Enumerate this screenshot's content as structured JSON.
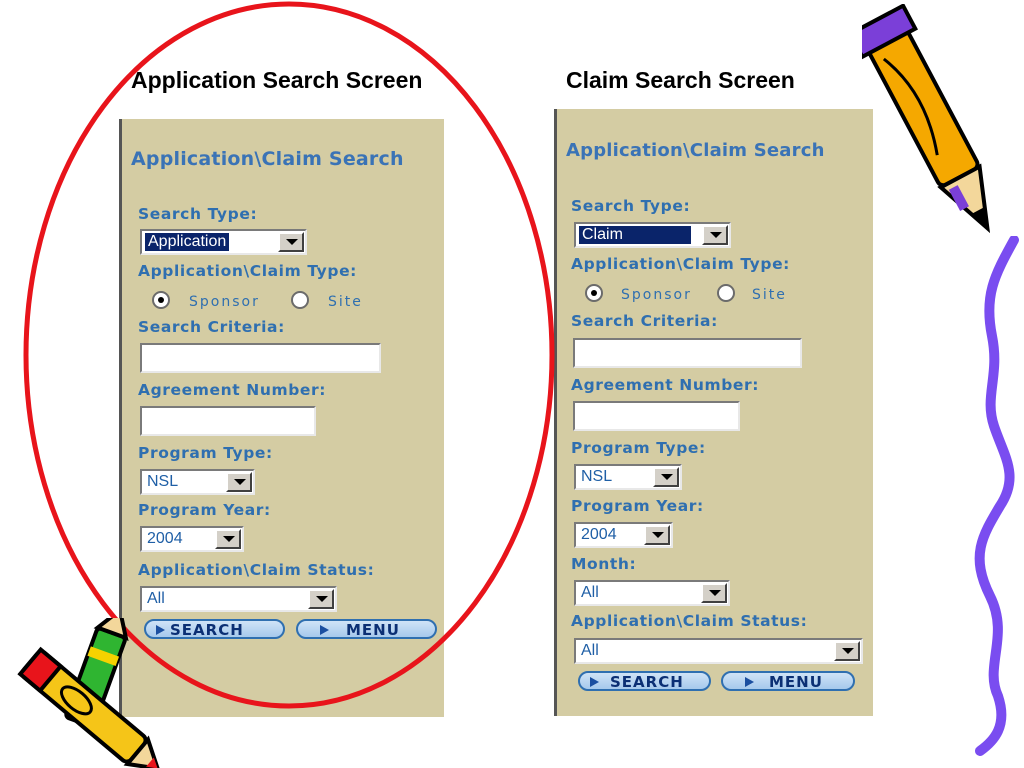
{
  "headings": {
    "left": "Application Search Screen",
    "right": "Claim Search Screen"
  },
  "left_panel": {
    "title": "Application\\Claim Search",
    "search_type_label": "Search Type:",
    "search_type_value": "Application",
    "type_label": "Application\\Claim Type:",
    "radio_sponsor": "Sponsor",
    "radio_site": "Site",
    "radio_selected": "Sponsor",
    "criteria_label": "Search Criteria:",
    "criteria_value": "",
    "agreement_label": "Agreement Number:",
    "agreement_value": "",
    "program_type_label": "Program Type:",
    "program_type_value": "NSL",
    "program_year_label": "Program Year:",
    "program_year_value": "2004",
    "status_label": "Application\\Claim Status:",
    "status_value": "All",
    "search_button": "SEARCH",
    "menu_button": "MENU"
  },
  "right_panel": {
    "title": "Application\\Claim Search",
    "search_type_label": "Search Type:",
    "search_type_value": "Claim",
    "type_label": "Application\\Claim Type:",
    "radio_sponsor": "Sponsor",
    "radio_site": "Site",
    "radio_selected": "Sponsor",
    "criteria_label": "Search Criteria:",
    "criteria_value": "",
    "agreement_label": "Agreement Number:",
    "agreement_value": "",
    "program_type_label": "Program Type:",
    "program_type_value": "NSL",
    "program_year_label": "Program Year:",
    "program_year_value": "2004",
    "month_label": "Month:",
    "month_value": "All",
    "status_label": "Application\\Claim Status:",
    "status_value": "All",
    "search_button": "SEARCH",
    "menu_button": "MENU"
  },
  "colors": {
    "panel_bg": "#d4cca3",
    "label_blue": "#2f6fb0",
    "highlight_ellipse": "#e8141b",
    "squiggle": "#7a4df0"
  },
  "decorations": [
    "pencil-clipart-icon",
    "crayons-clipart-icon",
    "squiggle-line"
  ]
}
